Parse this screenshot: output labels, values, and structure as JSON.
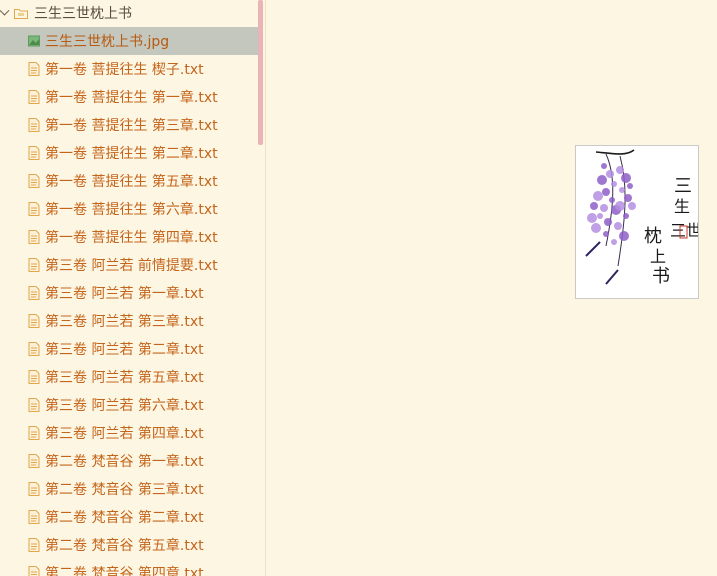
{
  "sidebar": {
    "folder": {
      "label": "三生三世枕上书",
      "icon": "folder-icon"
    },
    "selected_index": 0,
    "files": [
      {
        "label": "三生三世枕上书.jpg",
        "icon": "image-file-icon"
      },
      {
        "label": "第一卷 菩提往生 楔子.txt",
        "icon": "text-file-icon"
      },
      {
        "label": "第一卷 菩提往生 第一章.txt",
        "icon": "text-file-icon"
      },
      {
        "label": "第一卷 菩提往生 第三章.txt",
        "icon": "text-file-icon"
      },
      {
        "label": "第一卷 菩提往生 第二章.txt",
        "icon": "text-file-icon"
      },
      {
        "label": "第一卷 菩提往生 第五章.txt",
        "icon": "text-file-icon"
      },
      {
        "label": "第一卷 菩提往生 第六章.txt",
        "icon": "text-file-icon"
      },
      {
        "label": "第一卷 菩提往生 第四章.txt",
        "icon": "text-file-icon"
      },
      {
        "label": "第三卷 阿兰若 前情提要.txt",
        "icon": "text-file-icon"
      },
      {
        "label": "第三卷 阿兰若 第一章.txt",
        "icon": "text-file-icon"
      },
      {
        "label": "第三卷 阿兰若 第三章.txt",
        "icon": "text-file-icon"
      },
      {
        "label": "第三卷 阿兰若 第二章.txt",
        "icon": "text-file-icon"
      },
      {
        "label": "第三卷 阿兰若 第五章.txt",
        "icon": "text-file-icon"
      },
      {
        "label": "第三卷 阿兰若 第六章.txt",
        "icon": "text-file-icon"
      },
      {
        "label": "第三卷 阿兰若 第四章.txt",
        "icon": "text-file-icon"
      },
      {
        "label": "第二卷 梵音谷 第一章.txt",
        "icon": "text-file-icon"
      },
      {
        "label": "第二卷 梵音谷 第三章.txt",
        "icon": "text-file-icon"
      },
      {
        "label": "第二卷 梵音谷 第二章.txt",
        "icon": "text-file-icon"
      },
      {
        "label": "第二卷 梵音谷 第五章.txt",
        "icon": "text-file-icon"
      },
      {
        "label": "第二卷 梵音谷 第四章.txt",
        "icon": "text-file-icon"
      }
    ]
  },
  "preview": {
    "calligraphy_text": "三生三世枕上书",
    "seal_text": "印",
    "accent_colors": {
      "wisteria": "#9b6fd0",
      "ink": "#1a1a1a",
      "seal": "#c0392b"
    }
  },
  "colors": {
    "background": "#fdf6e3",
    "file_text": "#c4651b",
    "selection": "#c3c7bd",
    "scrollbar": "#eab3b7"
  }
}
